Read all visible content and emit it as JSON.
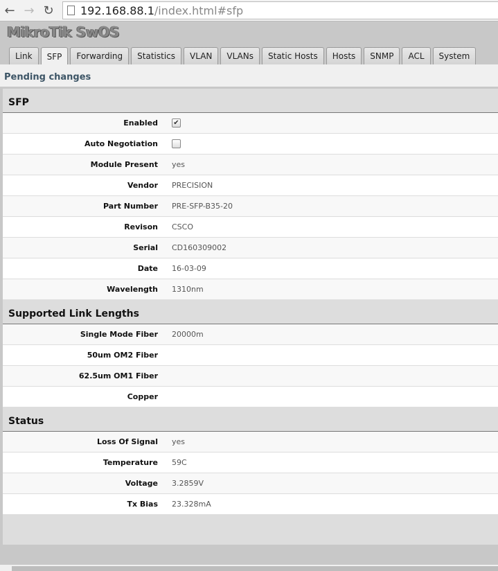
{
  "browser": {
    "url_host": "192.168.88.1",
    "url_path": "/index.html#sfp"
  },
  "app_title": "MikroTik SwOS",
  "tabs": [
    "Link",
    "SFP",
    "Forwarding",
    "Statistics",
    "VLAN",
    "VLANs",
    "Static Hosts",
    "Hosts",
    "SNMP",
    "ACL",
    "System"
  ],
  "active_tab": "SFP",
  "pending": "Pending changes",
  "sections": [
    {
      "title": "SFP",
      "rows": [
        {
          "label": "Enabled",
          "checkbox": true
        },
        {
          "label": "Auto Negotiation",
          "checkbox": false
        },
        {
          "label": "Module Present",
          "value": "yes"
        },
        {
          "label": "Vendor",
          "value": "PRECISION"
        },
        {
          "label": "Part Number",
          "value": "PRE-SFP-B35-20"
        },
        {
          "label": "Revison",
          "value": "CSCO"
        },
        {
          "label": "Serial",
          "value": "CD160309002"
        },
        {
          "label": "Date",
          "value": "16-03-09"
        },
        {
          "label": "Wavelength",
          "value": "1310nm"
        }
      ]
    },
    {
      "title": "Supported Link Lengths",
      "rows": [
        {
          "label": "Single Mode Fiber",
          "value": "20000m"
        },
        {
          "label": "50um OM2 Fiber",
          "value": ""
        },
        {
          "label": "62.5um OM1 Fiber",
          "value": ""
        },
        {
          "label": "Copper",
          "value": ""
        }
      ]
    },
    {
      "title": "Status",
      "rows": [
        {
          "label": "Loss Of Signal",
          "value": "yes"
        },
        {
          "label": "Temperature",
          "value": "59C"
        },
        {
          "label": "Voltage",
          "value": "3.2859V"
        },
        {
          "label": "Tx Bias",
          "value": "23.328mA"
        }
      ]
    }
  ]
}
